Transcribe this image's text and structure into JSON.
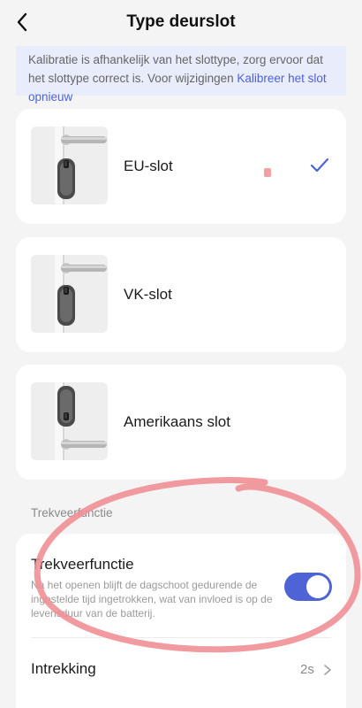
{
  "header": {
    "back_icon": "chevron-left-icon",
    "title": "Type deurslot"
  },
  "notice": {
    "text": "Kalibratie is afhankelijk van het slottype, zorg ervoor dat het slottype correct is. Voor wijzigingen ",
    "link": "Kalibreer het slot opnieuw"
  },
  "lock_types": [
    {
      "label": "EU-slot",
      "selected": true,
      "image_icon": "eu-lock-icon"
    },
    {
      "label": "VK-slot",
      "selected": false,
      "image_icon": "uk-lock-icon"
    },
    {
      "label": "Amerikaans slot",
      "selected": false,
      "image_icon": "us-lock-icon"
    }
  ],
  "selected_check_icon": "checkmark-icon",
  "section": {
    "label": "Trekveerfunctie"
  },
  "settings": {
    "spring": {
      "title": "Trekveerfunctie",
      "description": "Na het openen blijft de dagschoot gedurende de ingestelde tijd ingetrokken, wat van invloed is op de levensduur van de batterij.",
      "enabled": true
    },
    "retraction": {
      "title": "Intrekking",
      "value": "2s",
      "chevron_icon": "chevron-right-icon"
    }
  },
  "colors": {
    "accent": "#4d63d6",
    "notice_bg": "#e8ecfb",
    "annotation": "#f08f95"
  }
}
